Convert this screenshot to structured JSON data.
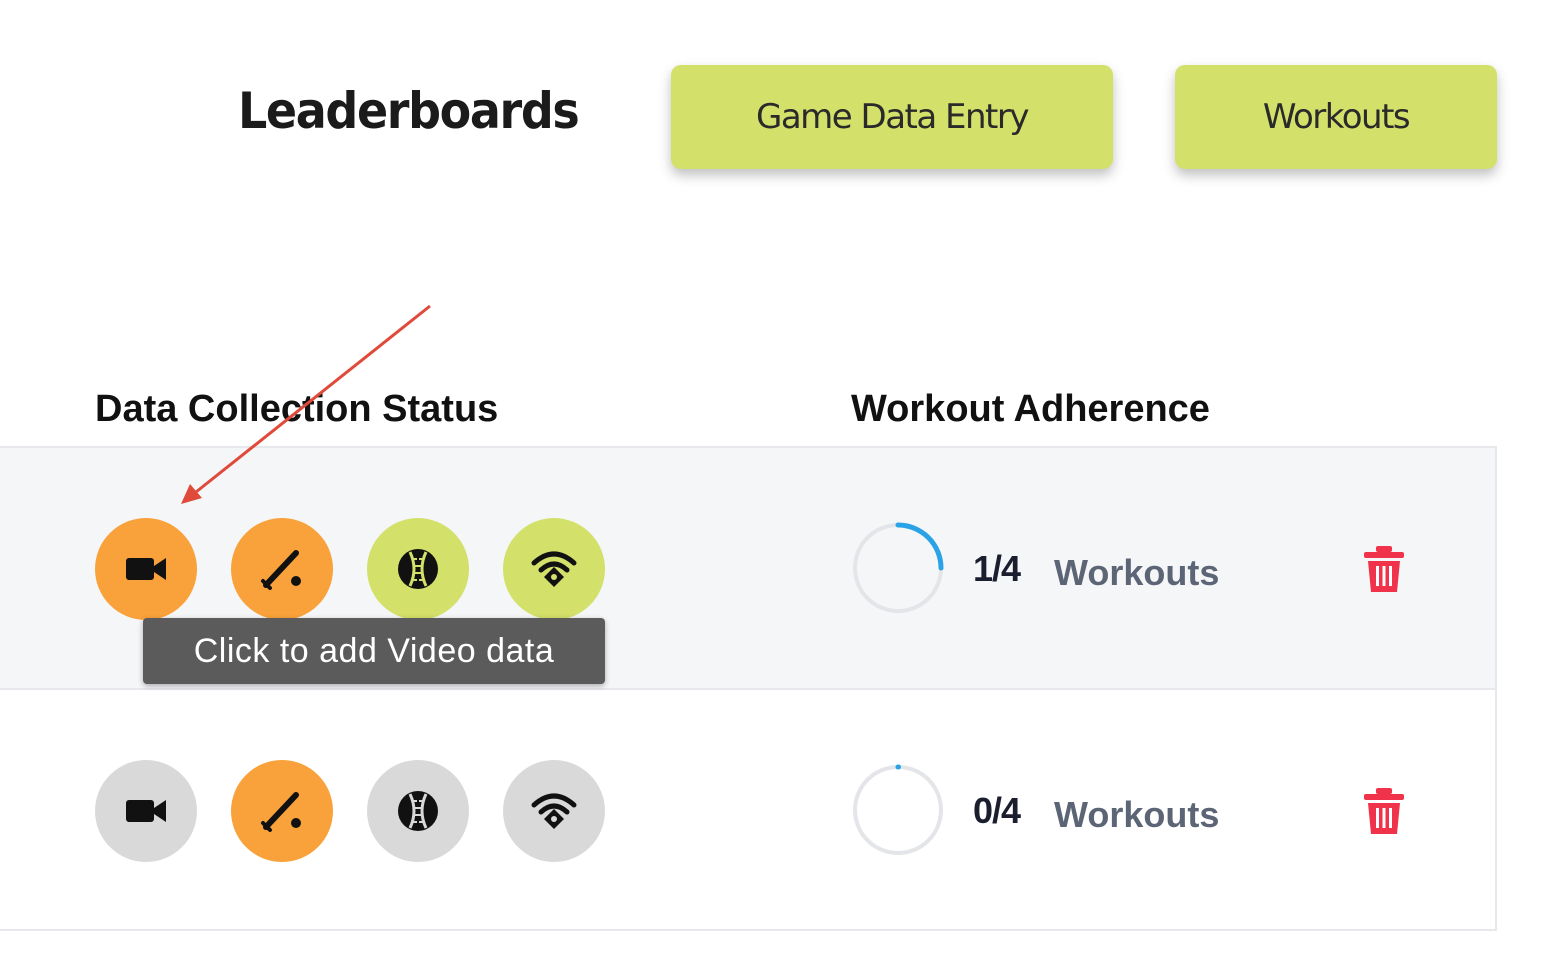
{
  "nav": {
    "title": "Leaderboards",
    "buttons": [
      {
        "label": "Game Data Entry"
      },
      {
        "label": "Workouts"
      }
    ]
  },
  "columns": {
    "status": "Data Collection Status",
    "adherence": "Workout Adherence"
  },
  "rows": [
    {
      "status_icons": [
        {
          "icon": "video-camera-icon",
          "state": "orange"
        },
        {
          "icon": "baseball-bat-icon",
          "state": "orange"
        },
        {
          "icon": "baseball-icon",
          "state": "green"
        },
        {
          "icon": "wireless-sensor-icon",
          "state": "green"
        }
      ],
      "workouts_done": "1/4",
      "workouts_label": "Workouts",
      "progress": 0.25
    },
    {
      "status_icons": [
        {
          "icon": "video-camera-icon",
          "state": "gray"
        },
        {
          "icon": "baseball-bat-icon",
          "state": "orange"
        },
        {
          "icon": "baseball-icon",
          "state": "gray"
        },
        {
          "icon": "wireless-sensor-icon",
          "state": "gray"
        }
      ],
      "workouts_done": "0/4",
      "workouts_label": "Workouts",
      "progress": 0
    }
  ],
  "tooltip": {
    "text": "Click to add Video data"
  },
  "colors": {
    "accent_green": "#d3e06a",
    "status_orange": "#f9a13a",
    "status_gray": "#d9d9d9",
    "progress_blue": "#29a3e6",
    "delete_red": "#f0334a",
    "annotation_arrow": "#e04a3a"
  }
}
